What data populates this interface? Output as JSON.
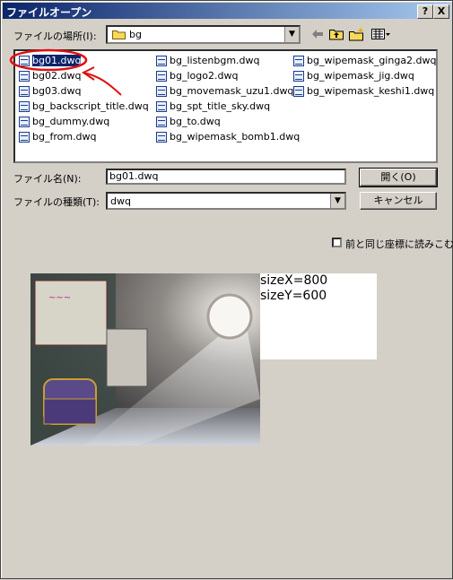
{
  "window": {
    "title": "ファイルオープン",
    "help_label": "?",
    "close_label": "X"
  },
  "location": {
    "label": "ファイルの場所(I):",
    "value": "bg"
  },
  "files": {
    "selected": "bg01.dwq",
    "columns": [
      [
        "bg01.dwq",
        "bg02.dwq",
        "bg03.dwq",
        "bg_backscript_title.dwq",
        "bg_dummy.dwq",
        "bg_from.dwq"
      ],
      [
        "bg_listenbgm.dwq",
        "bg_logo2.dwq",
        "bg_movemask_uzu1.dwq",
        "bg_spt_title_sky.dwq",
        "bg_to.dwq",
        "bg_wipemask_bomb1.dwq"
      ],
      [
        "bg_wipemask_ginga2.dwq",
        "bg_wipemask_jig.dwq",
        "bg_wipemask_keshi1.dwq"
      ]
    ]
  },
  "filename": {
    "label": "ファイル名(N):",
    "value": "bg01.dwq"
  },
  "filetype": {
    "label": "ファイルの種類(T):",
    "value": "dwq"
  },
  "buttons": {
    "open": "開く(O)",
    "cancel": "キャンセル"
  },
  "checkbox": {
    "label": "前と同じ座標に読みこむ"
  },
  "preview_info": {
    "sizeX": "sizeX=800",
    "sizeY": "sizeY=600"
  },
  "colors": {
    "titlebar": "#0a246a",
    "selection": "#0a246a",
    "annotation": "#e01010"
  },
  "icons": [
    "folder-icon",
    "back-arrow-icon",
    "up-folder-icon",
    "new-folder-icon",
    "view-menu-icon",
    "file-icon"
  ]
}
